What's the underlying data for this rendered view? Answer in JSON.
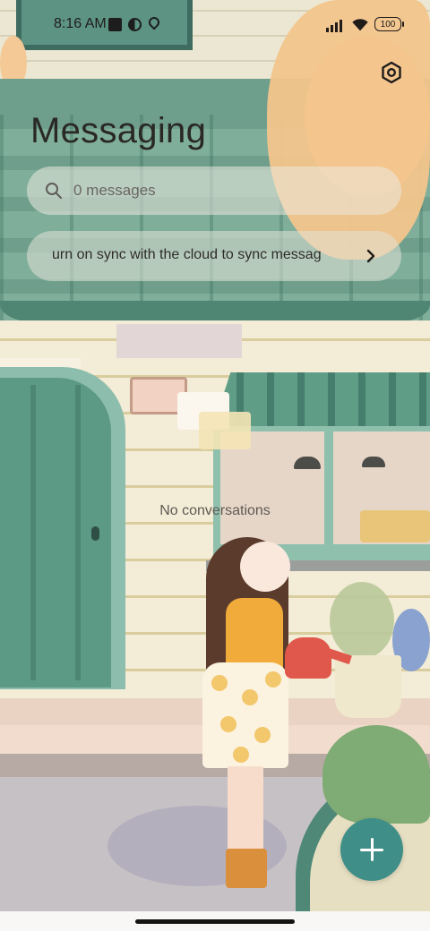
{
  "status_bar": {
    "time": "8:16 AM",
    "battery": "100",
    "icons": [
      "notification-square-icon",
      "app-circle-icon",
      "location-icon",
      "cellular-signal-icon",
      "wifi-icon",
      "battery-icon"
    ]
  },
  "header": {
    "title": "Messaging",
    "settings_icon": "settings-hexagon-icon"
  },
  "search": {
    "placeholder": "0 messages",
    "icon": "search-icon"
  },
  "sync_banner": {
    "text": "urn on sync with the cloud to sync messag",
    "icon": "chevron-right-icon"
  },
  "empty_state": {
    "text": "No conversations"
  },
  "fab": {
    "icon": "plus-icon"
  },
  "colors": {
    "accent": "#3f8f88",
    "title_text": "#2a2826"
  }
}
